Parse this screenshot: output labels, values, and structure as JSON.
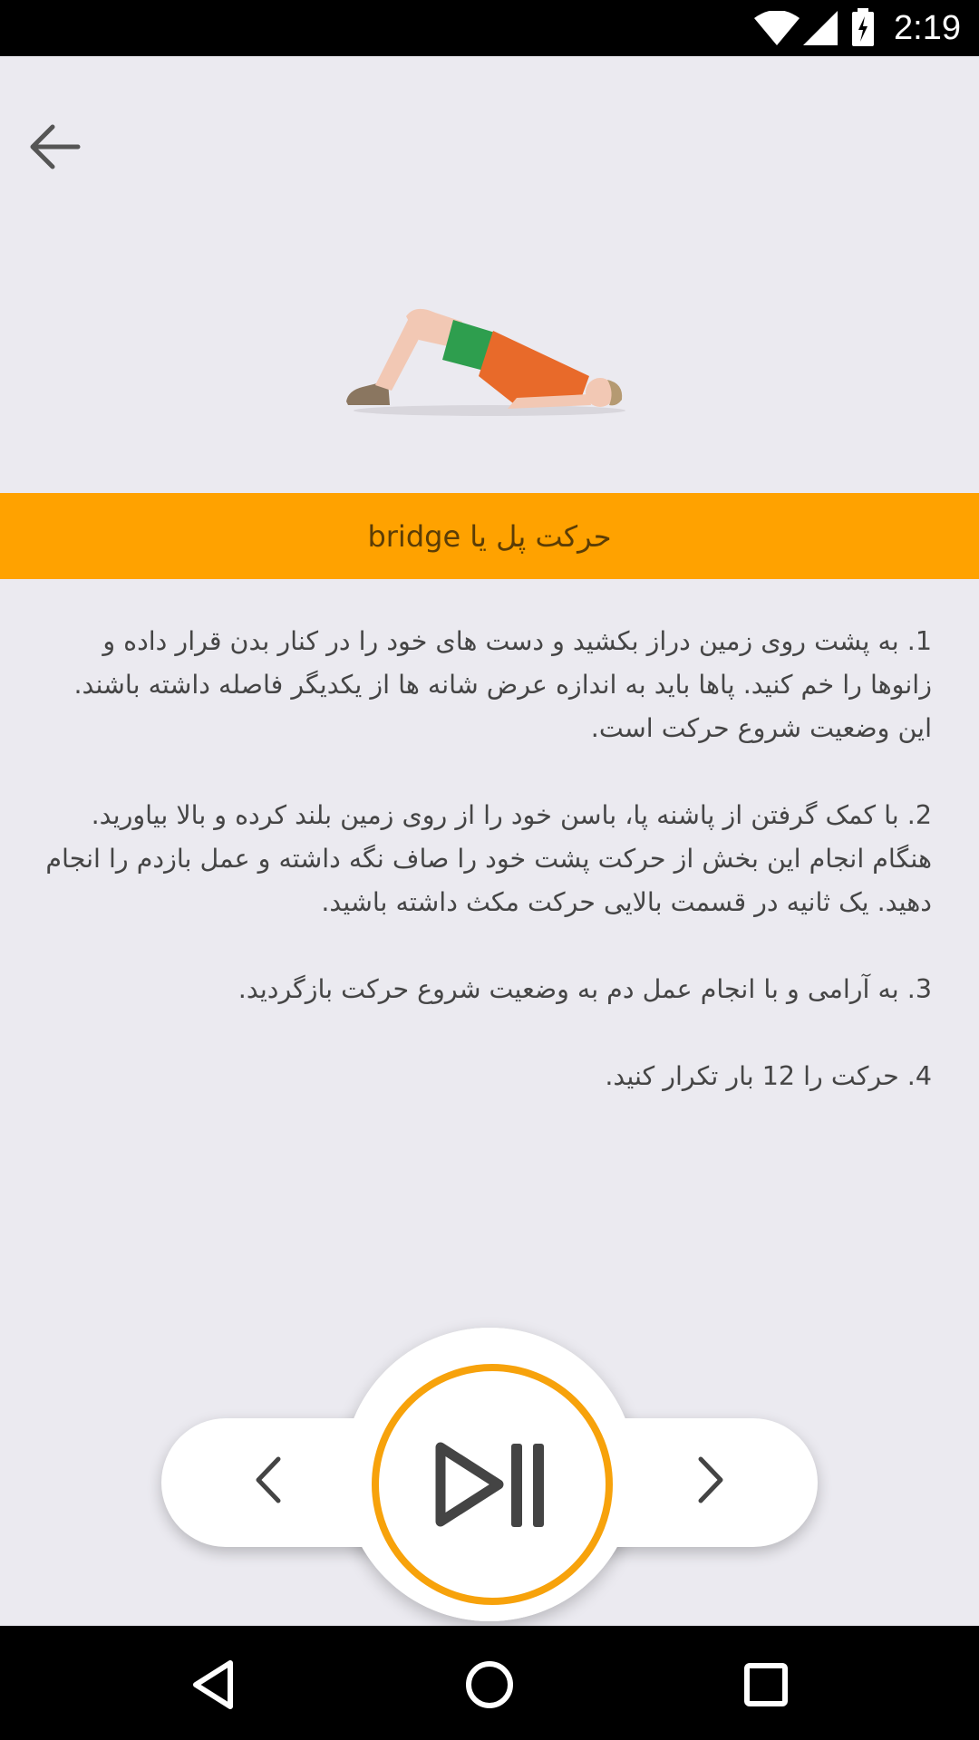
{
  "status_bar": {
    "time": "2:19"
  },
  "exercise": {
    "title": "حرکت پل یا bridge"
  },
  "instructions": {
    "steps": [
      "1.  به پشت روی زمین دراز بکشید و دست های خود را در کنار بدن قرار داده و زانوها را خم کنید. پاها باید به اندازه عرض شانه ها از یکدیگر فاصله داشته باشند. این وضعیت شروع حرکت است.",
      "2. با کمک گرفتن از پاشنه پا، باسن خود را از روی زمین بلند کرده و بالا بیاورید. هنگام انجام این بخش از حرکت پشت خود را صاف نگه داشته و عمل بازدم را انجام دهید. یک ثانیه در قسمت بالایی حرکت مکث داشته باشید.",
      "3. به آرامی و با انجام عمل دم به وضعیت شروع حرکت بازگردید.",
      "4. حرکت را 12 بار تکرار کنید."
    ]
  },
  "icons": {
    "back": "arrow-left-icon",
    "prev": "chevron-left-icon",
    "next": "chevron-right-icon",
    "play_pause": "play-pause-icon"
  },
  "colors": {
    "accent": "#FFA200",
    "ring": "#F7A20B",
    "background": "#EBEAF0",
    "title_text": "#5B3D06"
  }
}
